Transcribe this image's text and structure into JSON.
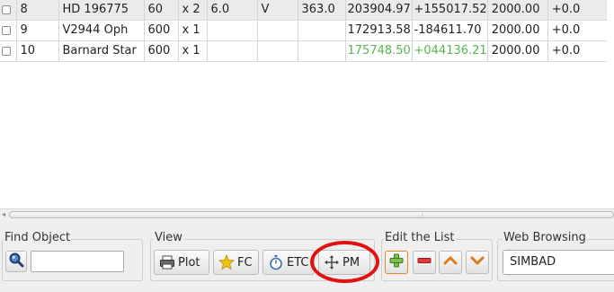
{
  "table": {
    "rows": [
      {
        "num": "8",
        "name": "HD 196775",
        "exp": "60",
        "rep": "x 2",
        "mag": "6.0",
        "filter": "V",
        "other": "363.0",
        "ra": "203904.97",
        "dec": "+155017.52",
        "epoch": "2000.00",
        "pm": "+0.0"
      },
      {
        "num": "9",
        "name": "V2944 Oph",
        "exp": "600",
        "rep": "x 1",
        "mag": "",
        "filter": "",
        "other": "",
        "ra": "172913.58",
        "dec": "-184611.70",
        "epoch": "2000.00",
        "pm": "+0.0"
      },
      {
        "num": "10",
        "name": "Barnard Star",
        "exp": "600",
        "rep": "x 1",
        "mag": "",
        "filter": "",
        "other": "",
        "ra": "175748.50",
        "dec": "+044136.21",
        "epoch": "2000.00",
        "pm": "+0.0"
      }
    ],
    "highlight_color": "#58b552"
  },
  "find_object": {
    "title": "Find Object",
    "search_icon": "magnifier-icon",
    "input_value": ""
  },
  "view": {
    "title": "View",
    "plot_label": "Plot",
    "fc_label": "FC",
    "etc_label": "ETC",
    "pm_label": "PM"
  },
  "edit_list": {
    "title": "Edit the List",
    "add_icon": "plus-icon",
    "remove_icon": "minus-icon",
    "up_icon": "chevron-up-icon",
    "down_icon": "chevron-down-icon"
  },
  "web_browsing": {
    "title": "Web Browsing",
    "selected": "SIMBAD"
  },
  "annotation": {
    "ring_color": "#e01212"
  }
}
